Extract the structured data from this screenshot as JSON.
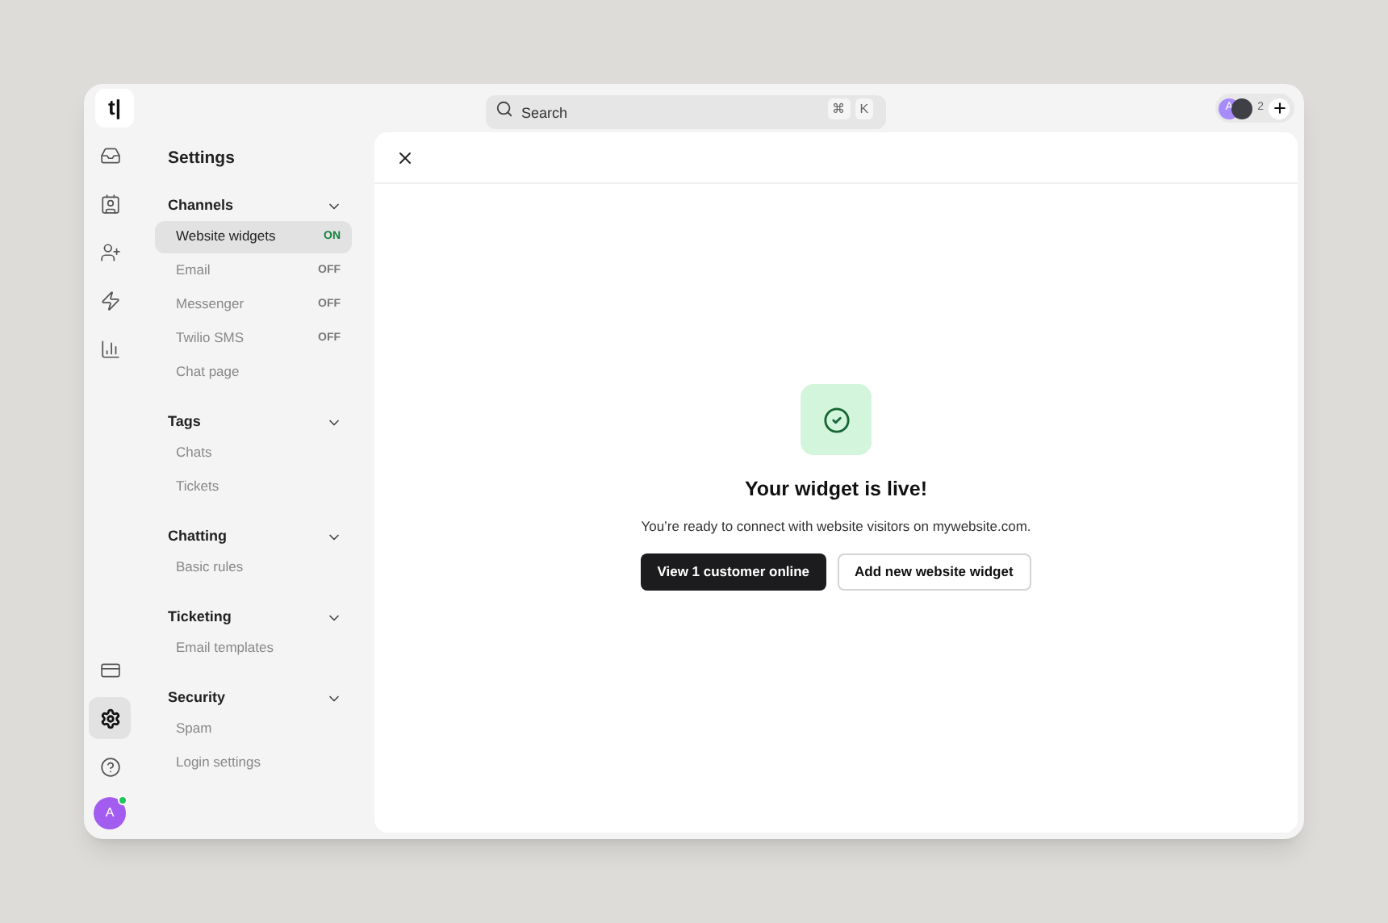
{
  "logo": "t|",
  "rail": {
    "top": [
      {
        "kind": "inbox",
        "selected": false
      },
      {
        "kind": "contacts",
        "selected": false
      },
      {
        "kind": "users",
        "selected": false
      },
      {
        "kind": "zap",
        "selected": false
      },
      {
        "kind": "chart",
        "selected": false
      }
    ],
    "bottom": [
      {
        "kind": "billing",
        "selected": false
      },
      {
        "kind": "settings",
        "selected": true
      },
      {
        "kind": "help",
        "selected": false
      }
    ],
    "avatar": {
      "initial": "A",
      "online": true
    }
  },
  "search": {
    "placeholder": "Search",
    "keys": [
      "⌘",
      "K"
    ]
  },
  "presence": {
    "avatars": [
      {
        "initial": "A",
        "color": "#a78bfa"
      },
      {
        "color": "#3f3f46"
      }
    ],
    "count": "2"
  },
  "settings": {
    "title": "Settings",
    "sections": [
      {
        "title": "Channels",
        "expanded": true,
        "items": [
          {
            "label": "Website widgets",
            "status": "ON",
            "on": true,
            "selected": true
          },
          {
            "label": "Email",
            "status": "OFF",
            "on": false,
            "selected": false
          },
          {
            "label": "Messenger",
            "status": "OFF",
            "on": false,
            "selected": false
          },
          {
            "label": "Twilio SMS",
            "status": "OFF",
            "on": false,
            "selected": false
          },
          {
            "label": "Chat page",
            "selected": false
          }
        ]
      },
      {
        "title": "Tags",
        "expanded": true,
        "items": [
          {
            "label": "Chats",
            "selected": false
          },
          {
            "label": "Tickets",
            "selected": false
          }
        ]
      },
      {
        "title": "Chatting",
        "expanded": true,
        "items": [
          {
            "label": "Basic rules",
            "selected": false
          }
        ]
      },
      {
        "title": "Ticketing",
        "expanded": true,
        "items": [
          {
            "label": "Email templates",
            "selected": false
          }
        ]
      },
      {
        "title": "Security",
        "expanded": true,
        "items": [
          {
            "label": "Spam",
            "selected": false
          },
          {
            "label": "Login settings",
            "selected": false
          }
        ]
      }
    ]
  },
  "panel": {
    "heading": "Your widget is live!",
    "message": "You’re ready to connect with website visitors on mywebsite.com.",
    "buttons": [
      {
        "label": "View 1 customer online",
        "kind": "primary"
      },
      {
        "label": "Add new website widget",
        "kind": "secondary"
      }
    ]
  }
}
